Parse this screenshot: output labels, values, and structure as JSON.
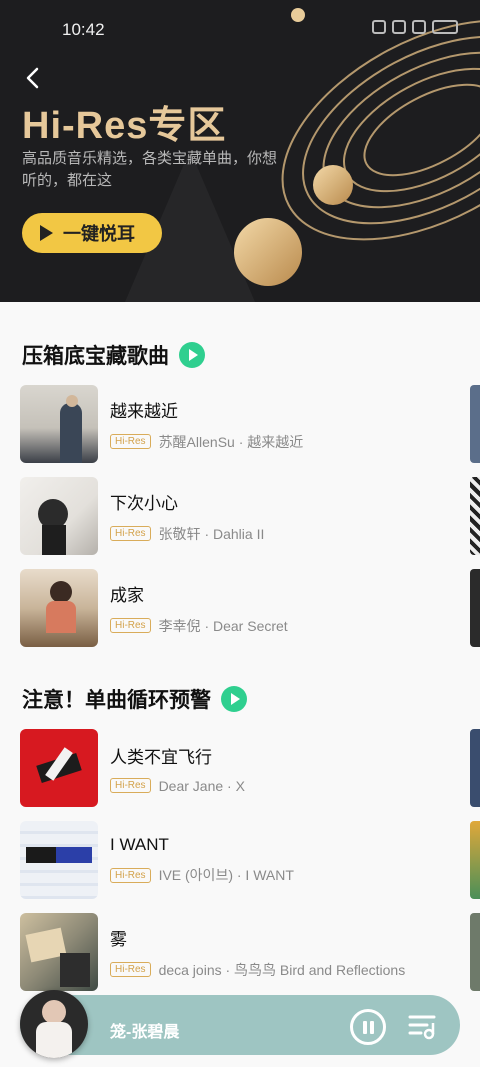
{
  "status_bar": {
    "time": "10:42"
  },
  "hero": {
    "title": "Hi-Res专区",
    "description": "高品质音乐精选，各类宝藏单曲，你想听的，都在这",
    "play_all_label": "一键悦耳"
  },
  "sections": [
    {
      "title": "压箱底宝藏歌曲",
      "songs": [
        {
          "title": "越来越近",
          "badge": "Hi-Res",
          "subtitle": "苏醒AllenSu · 越来越近"
        },
        {
          "title": "下次小心",
          "badge": "Hi-Res",
          "subtitle": "张敬轩 · Dahlia II"
        },
        {
          "title": "成家",
          "badge": "Hi-Res",
          "subtitle": "李幸倪 · Dear Secret"
        }
      ]
    },
    {
      "title": "注意！单曲循环预警",
      "songs": [
        {
          "title": "人类不宜飞行",
          "badge": "Hi-Res",
          "subtitle": "Dear Jane · X"
        },
        {
          "title": "I WANT",
          "badge": "Hi-Res",
          "subtitle": "IVE (아이브) · I WANT"
        },
        {
          "title": "雾",
          "badge": "Hi-Res",
          "subtitle": "deca joins · 鸟鸟鸟 Bird and Reflections"
        }
      ]
    }
  ],
  "player": {
    "now_playing": "笼-张碧晨"
  },
  "colors": {
    "accent_gold": "#e6c89a",
    "play_green": "#2fcf8f",
    "button_yellow": "#f2c744",
    "player_bg": "#9ec5c2"
  },
  "icons": [
    "back-arrow-icon",
    "play-icon",
    "pause-icon",
    "playlist-icon"
  ]
}
